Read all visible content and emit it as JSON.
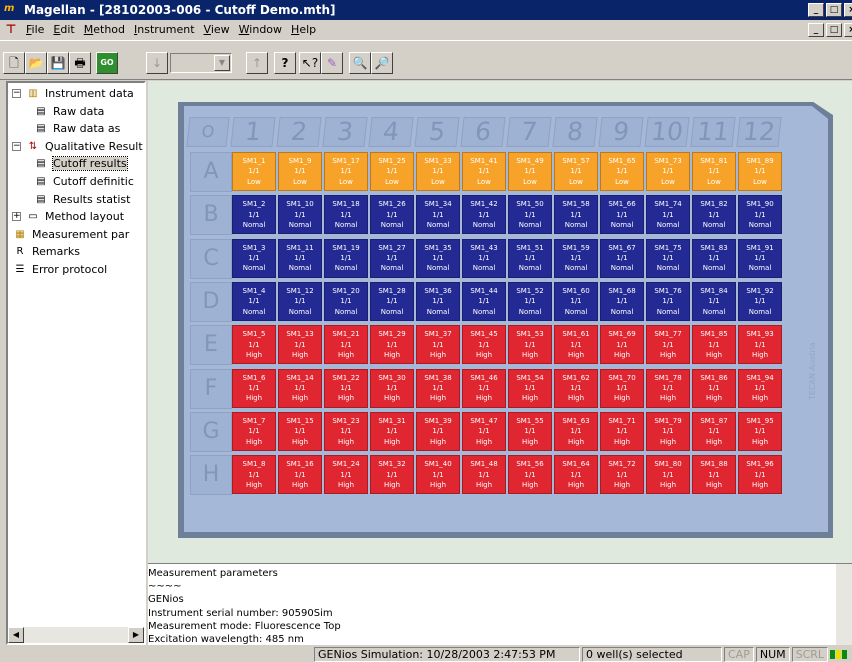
{
  "window": {
    "title": "Magellan - [28102003-006 - Cutoff Demo.mth]",
    "minimize": "_",
    "restore": "□",
    "close": "×"
  },
  "menu": [
    "File",
    "Edit",
    "Method",
    "Instrument",
    "View",
    "Window",
    "Help"
  ],
  "toolbar": [
    "new-icon",
    "open-icon",
    "save-icon",
    "print-icon",
    "go-icon",
    "down-arrow-icon",
    "combo",
    "up-arrow-icon",
    "help-icon",
    "context-help-icon",
    "wizard-icon",
    "zoom-icon",
    "zoom-edit-icon"
  ],
  "tree": [
    {
      "label": "Instrument data",
      "icon": "chart-icon",
      "level": 0,
      "exp": "−"
    },
    {
      "label": "Raw data",
      "icon": "doc-icon",
      "level": 1
    },
    {
      "label": "Raw data as",
      "icon": "doc-icon",
      "level": 1
    },
    {
      "label": "Qualitative Result",
      "icon": "qual-icon",
      "level": 0,
      "exp": "−"
    },
    {
      "label": "Cutoff results",
      "icon": "doc-icon",
      "level": 1,
      "selected": true
    },
    {
      "label": "Cutoff definitic",
      "icon": "doc-icon",
      "level": 1
    },
    {
      "label": "Results statist",
      "icon": "doc-icon",
      "level": 1
    },
    {
      "label": "Method layout",
      "icon": "layout-icon",
      "level": 0,
      "exp": "+"
    },
    {
      "label": "Measurement par",
      "icon": "params-icon",
      "level": 0
    },
    {
      "label": "Remarks",
      "icon": "remarks-icon",
      "level": 0
    },
    {
      "label": "Error protocol",
      "icon": "error-icon",
      "level": 0
    }
  ],
  "plate": {
    "corner": "O",
    "columns": [
      "1",
      "2",
      "3",
      "4",
      "5",
      "6",
      "7",
      "8",
      "9",
      "10",
      "11",
      "12"
    ],
    "rows": [
      "A",
      "B",
      "C",
      "D",
      "E",
      "F",
      "G",
      "H"
    ],
    "dilution": "1/1",
    "results": {
      "A": "Low",
      "B": "Normal",
      "C": "Normal",
      "D": "Normal",
      "E": "High",
      "F": "High",
      "G": "High",
      "H": "High"
    },
    "row_labels_text": {
      "Low": "Low",
      "Normal": "Nomal",
      "High": "High"
    },
    "watermark": "TECAN Austria",
    "colors": {
      "low": "#f7a329",
      "normal": "#242a94",
      "high": "#e02630"
    }
  },
  "params": [
    "Measurement parameters",
    "~~~~",
    "GENios",
    "Instrument serial number: 90590Sim",
    "Measurement mode: Fluorescence Top",
    "Excitation wavelength: 485 nm"
  ],
  "status": {
    "sim": "GENios Simulation: 10/28/2003 2:47:53 PM",
    "wells": "0 well(s) selected",
    "cap": "CAP",
    "num": "NUM",
    "scrl": "SCRL"
  }
}
